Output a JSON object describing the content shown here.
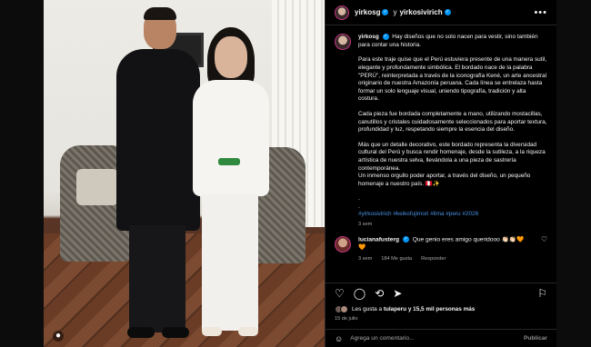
{
  "post": {
    "author": "yirkosg",
    "connector": "y",
    "coauthor": "yirkosivirich",
    "more_label": "•••"
  },
  "caption": {
    "username": "yirkosg",
    "intro": "Hay diseños que no solo nacen para vestir, sino también para contar una historia.",
    "paragraphs": [
      "Para este traje quise que el Perú estuviera presente de una manera sutil, elegante y profundamente simbólica. El bordado nace de la palabra \"PERÚ\", reinterpretada a través de la iconografía Kené, un arte ancestral originario de nuestra Amazonía peruana. Cada línea se entrelaza hasta formar un solo lenguaje visual, uniendo tipografía, tradición y alta costura.",
      "Cada pieza fue bordada completamente a mano, utilizando mostacillas, canutillos y cristales cuidadosamente seleccionados para aportar textura, profundidad y luz, respetando siempre la esencia del diseño.",
      "Más que un detalle decorativo, este bordado representa la diversidad cultural del Perú y busca rendir homenaje, desde la sutileza, a la riqueza artística de nuestra selva, llevándola a una pieza de sastrería contemporánea.\nUn inmenso orgullo poder aportar, a través del diseño, un pequeño homenaje a nuestro país. 🇵🇪✨"
    ],
    "dots": ".\n.",
    "hashtags": "#yirkosivirich #keikofujimori #lima #peru #2026",
    "age": "3 sem"
  },
  "comment": {
    "username": "lucianafusterg",
    "text": "Que genio eres amigo queridooo 👏🏻👏🏻🧡",
    "extra": "🧡",
    "age": "3 sem",
    "likes": "184 Me gusta",
    "reply": "Responder",
    "heart": "♡"
  },
  "actions": {
    "like_icon": "♡",
    "comment_icon": "◯",
    "repost_icon": "⟲",
    "share_icon": "➤",
    "save_icon": "⚐"
  },
  "likes": {
    "text_prefix": "Les gusta a",
    "user": "tulaperu",
    "text_suffix": "y 15,5 mil personas más"
  },
  "date": "15 de julio",
  "add_comment": {
    "emoji_icon": "☺",
    "placeholder": "Agrega un comentario...",
    "post_label": "Publicar"
  },
  "colors": {
    "background": "#000000",
    "verified": "#0095f6",
    "hashtag": "#4a90e2",
    "muted": "#a8a8a8"
  }
}
